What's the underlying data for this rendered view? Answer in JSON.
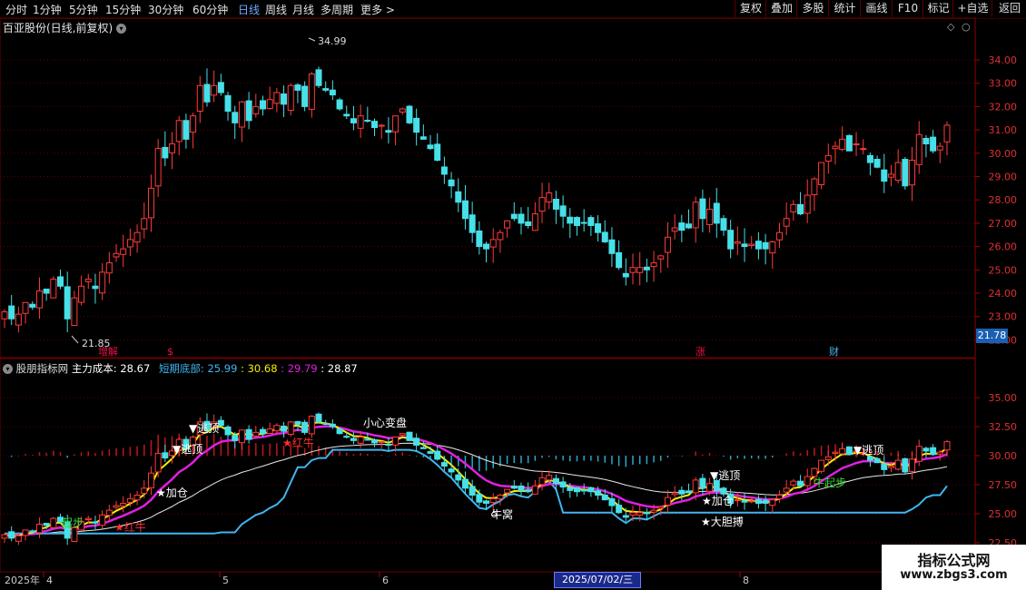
{
  "toolbar": {
    "periods": [
      "分时",
      "1分钟",
      "5分钟",
      "15分钟",
      "30分钟",
      "60分钟",
      "日线",
      "周线",
      "月线",
      "多周期",
      "更多 >"
    ],
    "active": "日线",
    "right_buttons": [
      "复权",
      "叠加",
      "多股",
      "统计",
      "画线",
      "F10",
      "标记",
      "+自选",
      "返回"
    ]
  },
  "stock": {
    "title": "百亚股份(日线,前复权)"
  },
  "price_axis": [
    "34.00",
    "33.00",
    "32.00",
    "31.00",
    "30.00",
    "29.00",
    "28.00",
    "27.00",
    "26.00",
    "25.00",
    "24.00",
    "23.00",
    "22.00"
  ],
  "indicator_axis": [
    "35.00",
    "32.50",
    "30.00",
    "27.50",
    "25.00",
    "22.50"
  ],
  "high_label": "34.99",
  "low_label": "21.85",
  "current_price": "21.78",
  "event_tags": {
    "zengjian": "增解",
    "s": "$",
    "zhang": "涨",
    "cai": "财"
  },
  "indicator": {
    "name": "股朋指标网",
    "main_cost_label": "主力成本:",
    "main_cost_value": "28.67",
    "short_bottom_label": "短期底部:",
    "short_bottom_value": "25.99",
    "v3": ": 30.68",
    "v4": ": 29.79",
    "v5": ": 28.87",
    "colors": {
      "main": "#ffffff",
      "short": "#3fb6f0",
      "yellow": "#f6f000",
      "magenta": "#e020e0"
    }
  },
  "annotations": {
    "xiaoxin": "小心变盘",
    "taoding1": "▼逃顶",
    "taoding2": "▼逃顶",
    "taoding3": "▼逃顶",
    "taoding4": "▼逃顶",
    "jiacang1": "★加仓",
    "jiacang2": "★加仓",
    "hongniu1": "★红牛",
    "hongniu2": "★红牛",
    "niuwo": "牛窝",
    "dadanbo": "★大胆搏",
    "niuqibu": "牛起步",
    "qibu": "起步"
  },
  "date_axis": {
    "start": "2025年",
    "m4": "4",
    "m5": "5",
    "m6": "6",
    "m8": "8",
    "cursor": "2025/07/02/三"
  },
  "watermark": {
    "line1": "指标公式网",
    "line2": "www.zbgs3.com"
  }
}
